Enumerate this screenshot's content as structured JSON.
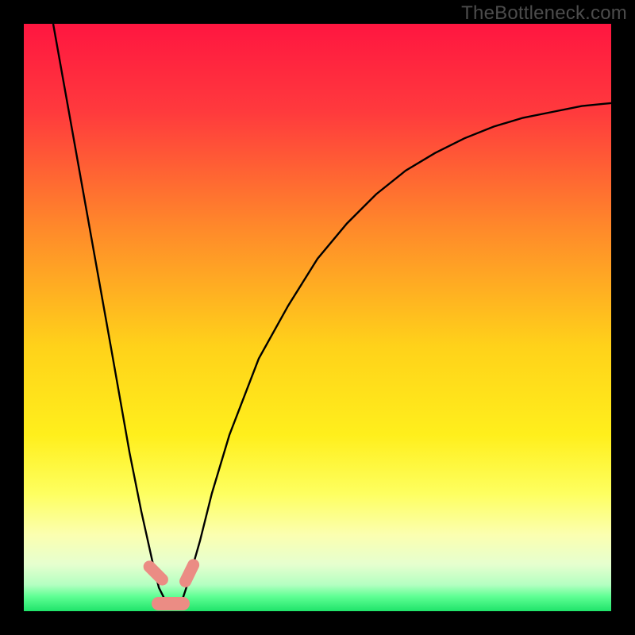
{
  "watermark": {
    "text": "TheBottleneck.com"
  },
  "chart_data": {
    "type": "line",
    "title": "",
    "xlabel": "",
    "ylabel": "",
    "x_range": [
      0,
      100
    ],
    "y_range": [
      0,
      100
    ],
    "series": [
      {
        "name": "bottleneck-curve",
        "x": [
          5,
          10,
          15,
          18,
          20,
          22,
          23,
          24,
          25,
          26,
          27,
          28,
          30,
          32,
          35,
          40,
          45,
          50,
          55,
          60,
          65,
          70,
          75,
          80,
          85,
          90,
          95,
          100
        ],
        "y": [
          100,
          72,
          44,
          27,
          17,
          8,
          4,
          2,
          1,
          1,
          2,
          5,
          12,
          20,
          30,
          43,
          52,
          60,
          66,
          71,
          75,
          78,
          80.5,
          82.5,
          84,
          85,
          86,
          86.5
        ]
      }
    ],
    "markers": [
      {
        "name": "left-nub",
        "x": 22.5,
        "y": 6.5,
        "rx": 1.0,
        "ry": 2.6,
        "angle": -45
      },
      {
        "name": "right-nub",
        "x": 28.2,
        "y": 6.5,
        "rx": 1.0,
        "ry": 2.6,
        "angle": 26
      },
      {
        "name": "bottom-bar",
        "x": 25.0,
        "y": 1.3,
        "rx": 3.2,
        "ry": 1.1,
        "angle": 0
      }
    ],
    "background_gradient": {
      "stops": [
        {
          "pos": 0.0,
          "color": "#ff1640"
        },
        {
          "pos": 0.15,
          "color": "#ff3a3d"
        },
        {
          "pos": 0.35,
          "color": "#ff8a2a"
        },
        {
          "pos": 0.55,
          "color": "#ffd21a"
        },
        {
          "pos": 0.7,
          "color": "#ffef1c"
        },
        {
          "pos": 0.8,
          "color": "#feff60"
        },
        {
          "pos": 0.87,
          "color": "#fbffb0"
        },
        {
          "pos": 0.92,
          "color": "#e6ffcf"
        },
        {
          "pos": 0.955,
          "color": "#b4ffc1"
        },
        {
          "pos": 0.975,
          "color": "#5fff94"
        },
        {
          "pos": 1.0,
          "color": "#1fe46a"
        }
      ]
    }
  }
}
